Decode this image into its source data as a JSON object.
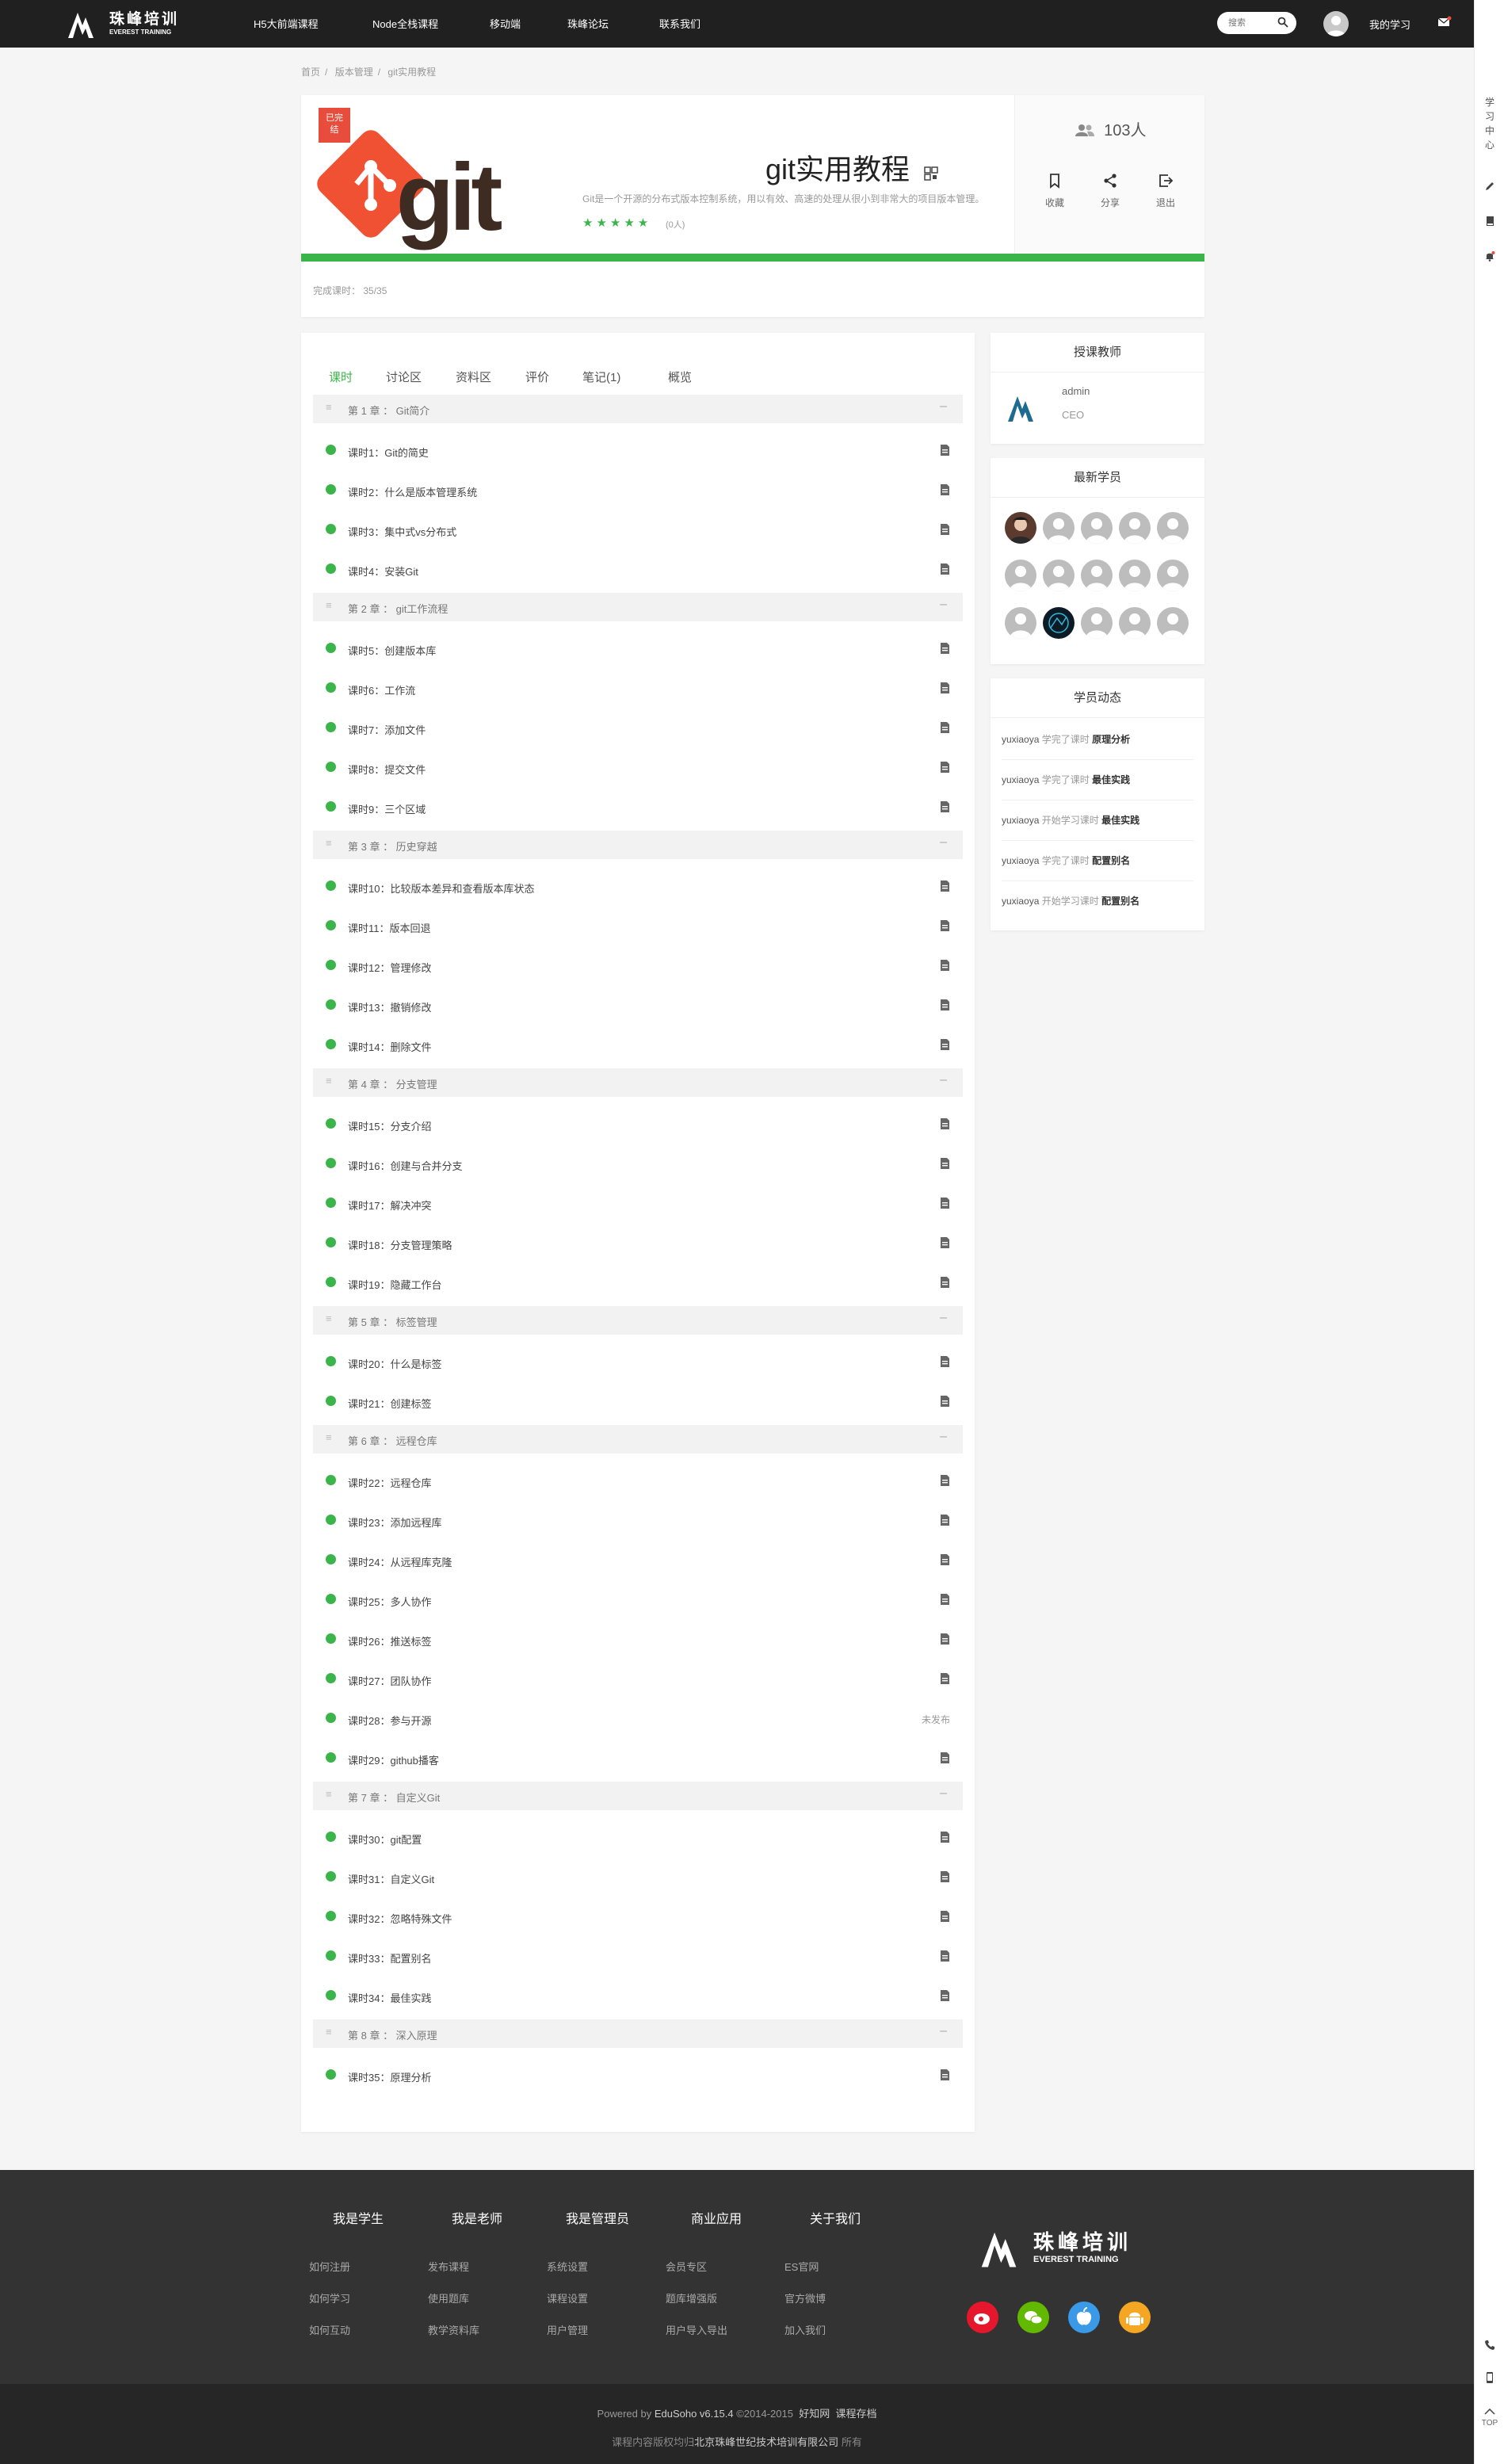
{
  "header": {
    "brand_cn": "珠峰培训",
    "brand_en": "EVEREST TRAINING",
    "nav": [
      "H5大前端课程",
      "Node全栈课程",
      "移动端",
      "珠峰论坛",
      "联系我们"
    ],
    "search_placeholder": "搜索",
    "my_learning": "我的学习"
  },
  "toolbar": {
    "learning_center": "学习中心",
    "top": "TOP"
  },
  "breadcrumb": [
    "首页",
    "版本管理",
    "git实用教程"
  ],
  "course": {
    "badge_line1": "已完",
    "badge_line2": "结",
    "cover_text": "git",
    "title": "git实用教程",
    "description": "Git是一个开源的分布式版本控制系统，用以有效、高速的处理从很小到非常大的项目版本管理。",
    "stars": "★★★★★",
    "rating_count": "(0人)",
    "students": "103人",
    "actions": [
      {
        "label": "收藏",
        "icon": "bookmark-icon"
      },
      {
        "label": "分享",
        "icon": "share-icon"
      },
      {
        "label": "退出",
        "icon": "exit-icon"
      }
    ],
    "progress_label": "完成课时：",
    "progress_value": "35/35",
    "progress_fraction": 1.0
  },
  "tabs": [
    "课时",
    "讨论区",
    "资料区",
    "评价",
    "笔记(1)",
    "概览"
  ],
  "chapters": [
    {
      "title": "第 1 章 ： Git简介",
      "lessons": [
        "课时1：Git的简史",
        "课时2：什么是版本管理系统",
        "课时3：集中式vs分布式",
        "课时4：安装Git"
      ]
    },
    {
      "title": "第 2 章 ： git工作流程",
      "lessons": [
        "课时5：创建版本库",
        "课时6：工作流",
        "课时7：添加文件",
        "课时8：提交文件",
        "课时9：三个区域"
      ]
    },
    {
      "title": "第 3 章 ： 历史穿越",
      "lessons": [
        "课时10：比较版本差异和查看版本库状态",
        "课时11：版本回退",
        "课时12：管理修改",
        "课时13：撤销修改",
        "课时14：删除文件"
      ]
    },
    {
      "title": "第 4 章 ： 分支管理",
      "lessons": [
        "课时15：分支介绍",
        "课时16：创建与合并分支",
        "课时17：解决冲突",
        "课时18：分支管理策略",
        "课时19：隐藏工作台"
      ]
    },
    {
      "title": "第 5 章 ： 标签管理",
      "lessons": [
        "课时20：什么是标签",
        "课时21：创建标签"
      ]
    },
    {
      "title": "第 6 章 ： 远程仓库",
      "lessons": [
        "课时22：远程仓库",
        "课时23：添加远程库",
        "课时24：从远程库克隆",
        "课时25：多人协作",
        "课时26：推送标签",
        "课时27：团队协作",
        "课时28：参与开源",
        "课时29：github播客"
      ]
    },
    {
      "title": "第 7 章 ： 自定义Git",
      "lessons": [
        "课时30：git配置",
        "课时31：自定义Git",
        "课时32：忽略特殊文件",
        "课时33：配置别名",
        "课时34：最佳实践"
      ]
    },
    {
      "title": "第 8 章 ： 深入原理",
      "lessons": [
        "课时35：原理分析"
      ]
    }
  ],
  "unpublished_lesson": "课时28：参与开源",
  "unpublished_label": "未发布",
  "teacher": {
    "heading": "授课教师",
    "name": "admin",
    "title": "CEO"
  },
  "latest_students": {
    "heading": "最新学员"
  },
  "activity": {
    "heading": "学员动态",
    "items": [
      {
        "user": "yuxiaoya",
        "verb": "学完了课时",
        "lesson": "原理分析"
      },
      {
        "user": "yuxiaoya",
        "verb": "学完了课时",
        "lesson": "最佳实践"
      },
      {
        "user": "yuxiaoya",
        "verb": "开始学习课时",
        "lesson": "最佳实践"
      },
      {
        "user": "yuxiaoya",
        "verb": "学完了课时",
        "lesson": "配置别名"
      },
      {
        "user": "yuxiaoya",
        "verb": "开始学习课时",
        "lesson": "配置别名"
      }
    ]
  },
  "footer": {
    "columns": [
      {
        "title": "我是学生",
        "links": [
          "如何注册",
          "如何学习",
          "如何互动"
        ]
      },
      {
        "title": "我是老师",
        "links": [
          "发布课程",
          "使用题库",
          "教学资料库"
        ]
      },
      {
        "title": "我是管理员",
        "links": [
          "系统设置",
          "课程设置",
          "用户管理"
        ]
      },
      {
        "title": "商业应用",
        "links": [
          "会员专区",
          "题库增强版",
          "用户导入导出"
        ]
      },
      {
        "title": "关于我们",
        "links": [
          "ES官网",
          "官方微博",
          "加入我们"
        ]
      }
    ],
    "brand_cn": "珠峰培训",
    "brand_en": "EVEREST TRAINING",
    "powered_prefix": "Powered by",
    "powered_product": "EduSoho v6.15.4",
    "powered_suffix": "©2014-2015",
    "powered_link1": "好知网",
    "powered_link2": "课程存档",
    "copyright_prefix": "课程内容版权均归",
    "copyright_company": "北京珠峰世纪技术培训有限公司",
    "copyright_suffix": "所有"
  },
  "colors": {
    "accent": "#3bb54a",
    "header": "#202020",
    "badge": "#e74c3c",
    "git_logo": "#f05133"
  }
}
